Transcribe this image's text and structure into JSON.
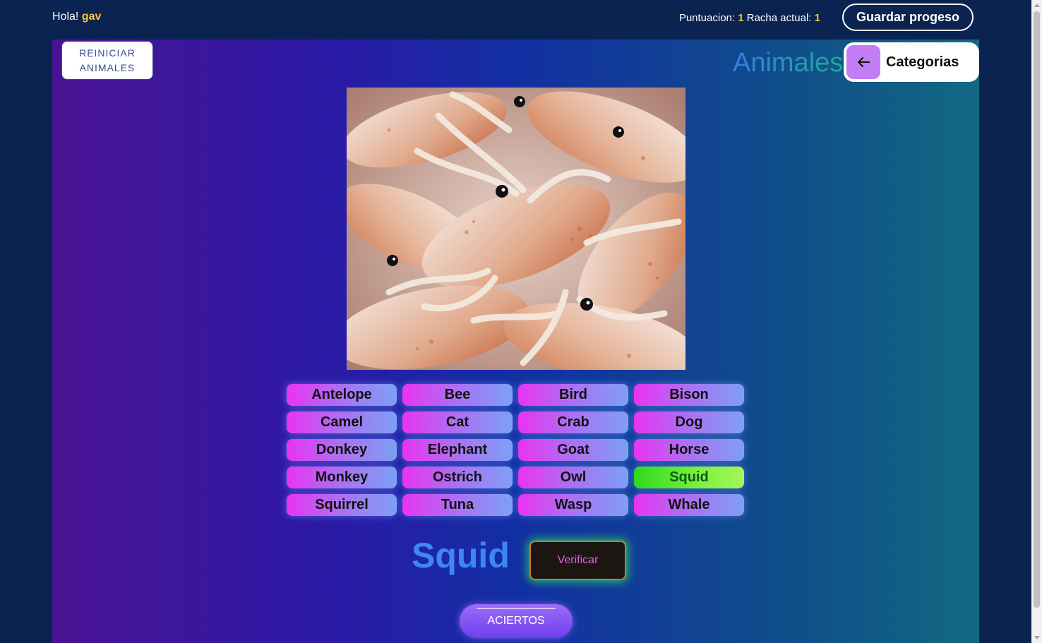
{
  "header": {
    "greeting": "Hola!",
    "username": "gav",
    "score_label": "Puntuacion:",
    "score_value": "1",
    "streak_label": "Racha actual:",
    "streak_value": "1",
    "save_label": "Guardar progeso"
  },
  "game": {
    "reset_label": "REINICIAR ANIMALES",
    "category_title": "Animales",
    "categories_button_label": "Categorias",
    "image_subject": "squid",
    "options": [
      "Antelope",
      "Bee",
      "Bird",
      "Bison",
      "Camel",
      "Cat",
      "Crab",
      "Dog",
      "Donkey",
      "Elephant",
      "Goat",
      "Horse",
      "Monkey",
      "Ostrich",
      "Owl",
      "Squid",
      "Squirrel",
      "Tuna",
      "Wasp",
      "Whale"
    ],
    "selected_option": "Squid",
    "answer_text": "Squid",
    "verify_label": "Verificar",
    "hits_label": "ACIERTOS"
  },
  "colors": {
    "accent_yellow": "#f8c72b",
    "selected_green": "#5be52a",
    "option_pink": "#e933f2",
    "answer_blue": "#3e86f3"
  },
  "icons": {
    "back": "arrow-left-icon"
  }
}
